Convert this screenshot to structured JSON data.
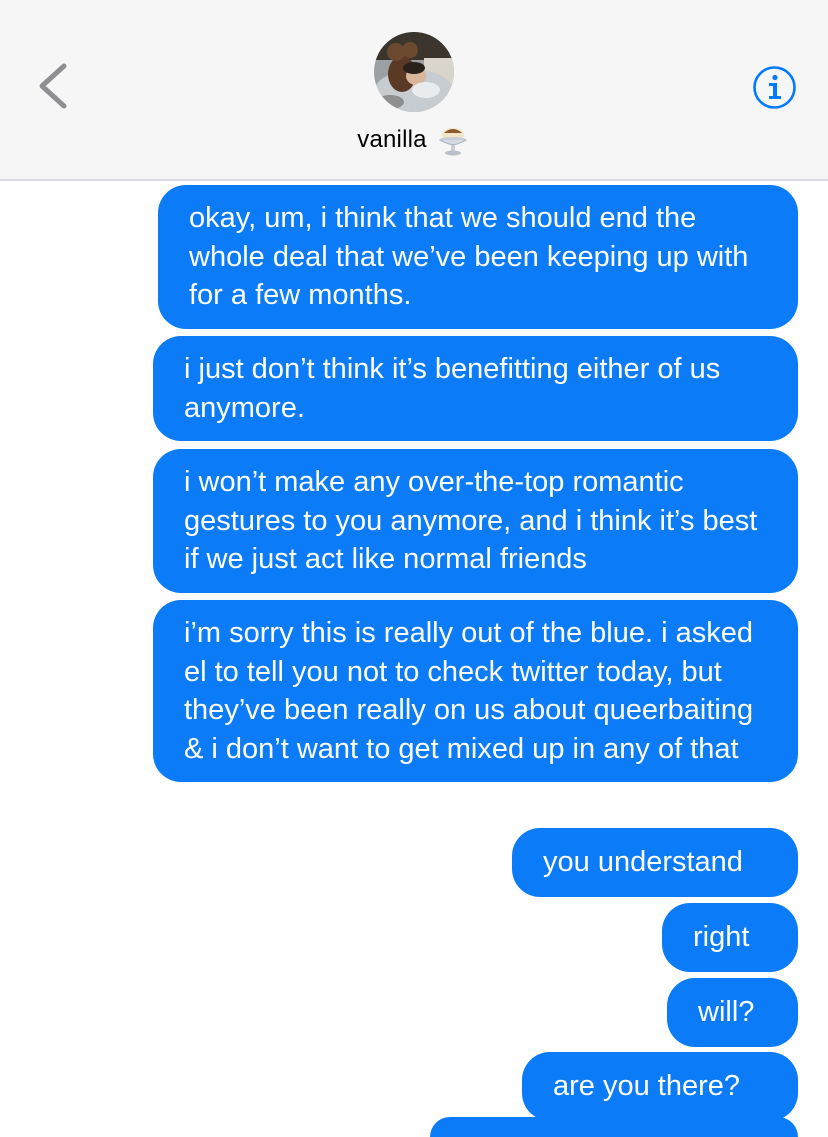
{
  "header": {
    "contact_name": "vanilla",
    "contact_emoji": "ice-cream-sundae-emoji",
    "back_icon": "chevron-left-icon",
    "info_icon": "info-icon",
    "accent_color": "#007aff"
  },
  "thread": {
    "bubble_color": "#0b7bf7",
    "messages": [
      {
        "direction": "sent",
        "text": "okay, um, i think that we should end the whole deal that we’ve been keeping up with for a few months."
      },
      {
        "direction": "sent",
        "text": "i just don’t think it’s benefitting either of us anymore."
      },
      {
        "direction": "sent",
        "text": "i won’t make any over-the-top romantic gestures to you anymore, and i think it’s best if we just act like normal friends"
      },
      {
        "direction": "sent",
        "text": "i’m sorry this is really out of the blue. i asked el to tell you not to check twitter today, but they’ve been really on us about queerbaiting & i don’t want to get mixed up in any of that"
      },
      {
        "direction": "sent",
        "text": "you understand"
      },
      {
        "direction": "sent",
        "text": "right"
      },
      {
        "direction": "sent",
        "text": "will?"
      },
      {
        "direction": "sent",
        "text": "are you there?"
      }
    ]
  }
}
